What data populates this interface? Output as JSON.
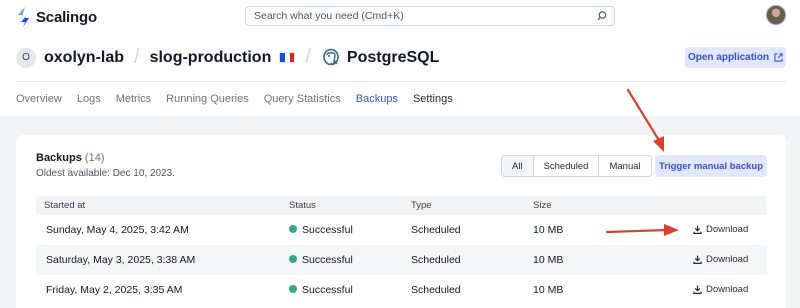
{
  "topbar": {
    "brand": "Scalingo",
    "search_placeholder": "Search what you need (Cmd+K)"
  },
  "header": {
    "app_initial": "O",
    "owner": "oxolyn-lab",
    "app": "slog-production",
    "region_flag": "france-flag",
    "addon": "PostgreSQL",
    "open_app_label": "Open application"
  },
  "tabs": [
    "Overview",
    "Logs",
    "Metrics",
    "Running Queries",
    "Query Statistics",
    "Backups",
    "Settings"
  ],
  "active_tab": "Backups",
  "backups": {
    "title": "Backups",
    "count": "(14)",
    "oldest": "Oldest available: Dec 10, 2023.",
    "filters": [
      "All",
      "Scheduled",
      "Manual"
    ],
    "trigger_label": "Trigger manual backup",
    "columns": [
      "Started at",
      "Status",
      "Type",
      "Size"
    ],
    "rows": [
      {
        "started": "Sunday, May 4, 2025, 3:42 AM",
        "status": "Successful",
        "type": "Scheduled",
        "size": "10 MB",
        "action": "Download"
      },
      {
        "started": "Saturday, May 3, 2025, 3:38 AM",
        "status": "Successful",
        "type": "Scheduled",
        "size": "10 MB",
        "action": "Download"
      },
      {
        "started": "Friday, May 2, 2025, 3:35 AM",
        "status": "Successful",
        "type": "Scheduled",
        "size": "10 MB",
        "action": "Download"
      }
    ]
  },
  "colors": {
    "accent": "#3b4fd1",
    "accent_bg": "#e0e7ff",
    "success": "#34a88a",
    "annotation_arrow": "#d9412b"
  }
}
